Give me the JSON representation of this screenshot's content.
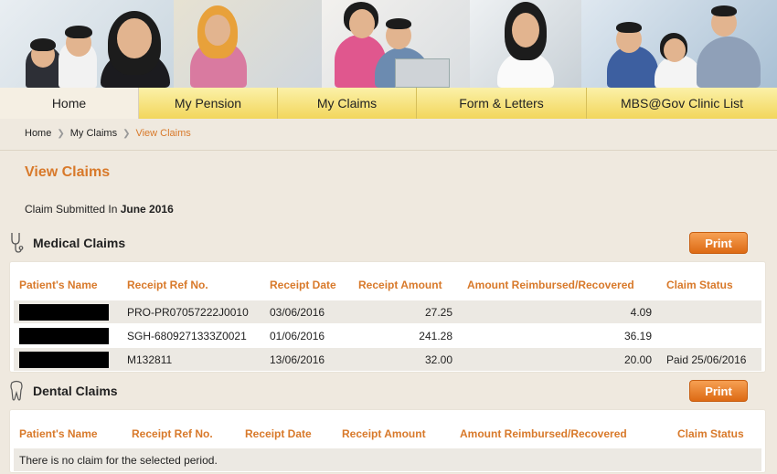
{
  "nav": {
    "tabs": [
      "Home",
      "My Pension",
      "My Claims",
      "Form & Letters",
      "MBS@Gov Clinic List"
    ]
  },
  "breadcrumb": {
    "home": "Home",
    "claims": "My Claims",
    "current": "View Claims"
  },
  "page": {
    "title": "View Claims",
    "submitted_prefix": "Claim Submitted In ",
    "submitted_period": "June 2016"
  },
  "medical": {
    "title": "Medical Claims",
    "print_label": "Print",
    "icon": "stethoscope-icon",
    "columns": [
      "Patient's Name",
      "Receipt Ref No.",
      "Receipt Date",
      "Receipt Amount",
      "Amount Reimbursed/Recovered",
      "Claim Status"
    ],
    "rows": [
      {
        "ref": "PRO-PR07057222J0010",
        "date": "03/06/2016",
        "amount": "27.25",
        "reimbursed": "4.09",
        "status": ""
      },
      {
        "ref": "SGH-6809271333Z0021",
        "date": "01/06/2016",
        "amount": "241.28",
        "reimbursed": "36.19",
        "status": ""
      },
      {
        "ref": "M132811",
        "date": "13/06/2016",
        "amount": "32.00",
        "reimbursed": "20.00",
        "status": "Paid 25/06/2016"
      }
    ]
  },
  "dental": {
    "title": "Dental Claims",
    "print_label": "Print",
    "icon": "tooth-icon",
    "columns": [
      "Patient's Name",
      "Receipt Ref No.",
      "Receipt Date",
      "Receipt Amount",
      "Amount Reimbursed/Recovered",
      "Claim Status"
    ],
    "empty_message": "There is no claim for the selected period."
  },
  "colors": {
    "accent": "#d8792a",
    "tab_yellow": "#f2d65c",
    "print_orange": "#e8772a"
  }
}
